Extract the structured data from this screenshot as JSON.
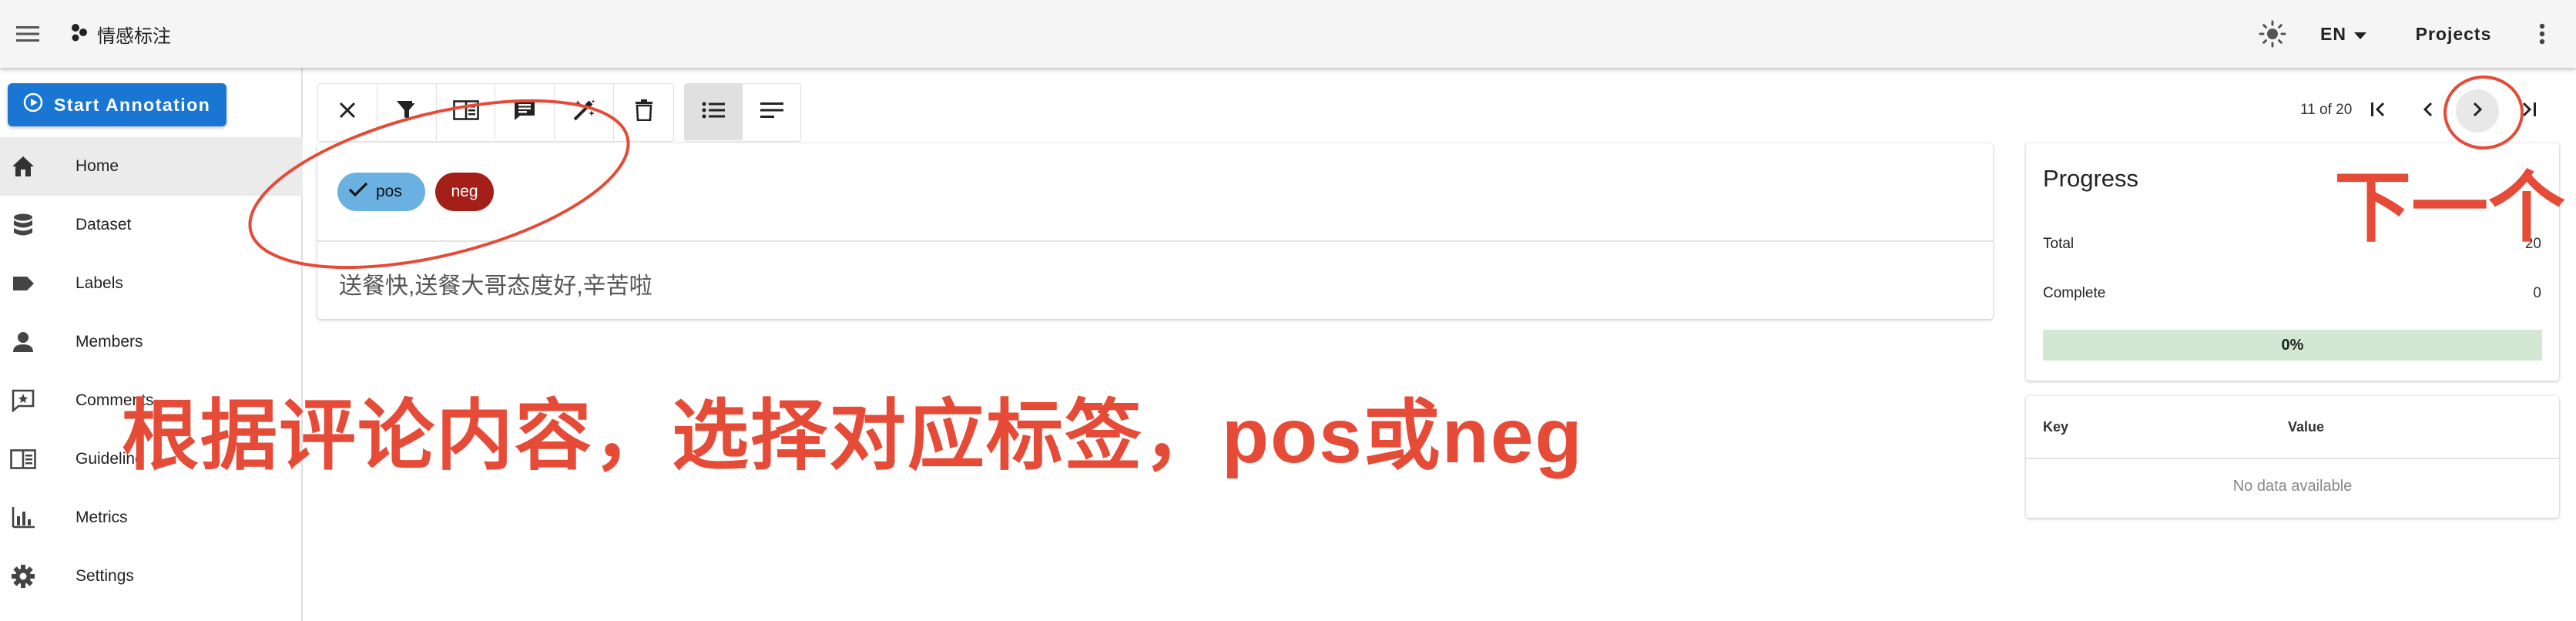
{
  "header": {
    "title": "情感标注",
    "language": "EN",
    "projects_label": "Projects"
  },
  "sidebar": {
    "start_label": "Start Annotation",
    "items": [
      {
        "label": "Home",
        "icon": "home-icon"
      },
      {
        "label": "Dataset",
        "icon": "database-icon"
      },
      {
        "label": "Labels",
        "icon": "label-icon"
      },
      {
        "label": "Members",
        "icon": "person-icon"
      },
      {
        "label": "Comments",
        "icon": "comment-icon"
      },
      {
        "label": "Guideline",
        "icon": "book-icon"
      },
      {
        "label": "Metrics",
        "icon": "bar-chart-icon"
      },
      {
        "label": "Settings",
        "icon": "gear-icon"
      }
    ]
  },
  "toolbar": {
    "buttons": [
      "close-icon",
      "filter-icon",
      "book-open-icon",
      "comment-icon",
      "auto-fix-icon",
      "delete-icon"
    ],
    "view_buttons": [
      "list-icon",
      "text-icon"
    ]
  },
  "pager": {
    "text": "11 of 20"
  },
  "annotation": {
    "labels": [
      {
        "text": "pos",
        "selected": true,
        "color": "#6ab0e0"
      },
      {
        "text": "neg",
        "selected": false,
        "color": "#a31f18"
      }
    ],
    "text": "送餐快,送餐大哥态度好,辛苦啦"
  },
  "progress": {
    "title": "Progress",
    "total_label": "Total",
    "total_value": "20",
    "complete_label": "Complete",
    "complete_value": "0",
    "percent": 0,
    "percent_label": "0%"
  },
  "meta_table": {
    "key_header": "Key",
    "value_header": "Value",
    "empty_text": "No data available"
  },
  "overlay_annotations": {
    "instruction": "根据评论内容，选择对应标签，pos或neg",
    "next_hint": "下一个",
    "color": "#e54b37"
  }
}
